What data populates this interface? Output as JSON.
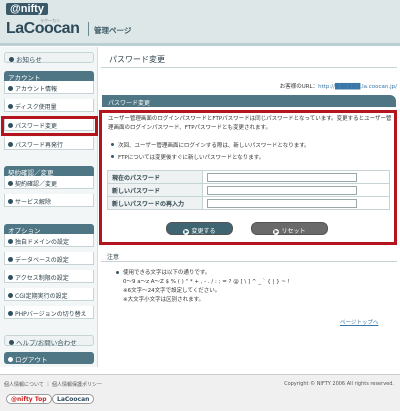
{
  "header": {
    "nifty": "@nifty",
    "ruby": "ラクーカン",
    "logo": "LaCoocan",
    "subtitle": "管理ページ"
  },
  "sidebar": {
    "notice": "お知らせ",
    "account_head": "アカウント",
    "account_items": [
      "アカウント情報",
      "ディスク使用量",
      "パスワード変更",
      "パスワード再発行"
    ],
    "contract_head": "契約確認／変更",
    "contract_items": [
      "契約確認／変更",
      "サービス解除"
    ],
    "option_head": "オプション",
    "option_items": [
      "独自ドメインの設定",
      "データベースの設定",
      "アクセス制限の設定",
      "CGI定期実行の設定",
      "PHPバージョンの切り替え"
    ],
    "help": "ヘルプ/お問い合わせ",
    "logout": "ログアウト"
  },
  "main": {
    "title": "パスワード変更",
    "welcome_prefix": "お客様のURL：",
    "welcome_url": "http://██████.la.coocan.jp/",
    "section": "パスワード変更",
    "desc": "ユーザー管理画面のログインパスワードとFTPパスワードは同じパスワードとなっています。変更するとユーザー管理画面のログインパスワード、FTPパスワードとも変更されます。",
    "note1": "次回、ユーザー管理画面にログインする際は、新しいパスワードとなります。",
    "note2": "FTPについては変更後すぐに新しいパスワードとなります。",
    "fields": [
      {
        "label": "現在のパスワード",
        "value": ""
      },
      {
        "label": "新しいパスワード",
        "value": ""
      },
      {
        "label": "新しいパスワードの再入力",
        "value": ""
      }
    ],
    "submit": "変更する",
    "reset": "リセット",
    "caution_title": "注意",
    "caution_lines": [
      "使用できる文字は以下の通りです。",
      "0〜9 a〜z A〜Z $ % ( ) \" * + , - . / : ; = ? @ [ \\ ] ^ _ ` { | } ~ !",
      "※6文字〜24文字で設定してください。",
      "※大文字小文字は区別されます。"
    ],
    "page_top": "ページトップへ"
  },
  "footer": {
    "links": "個人情報について ｜ 個人情報保護ポリシー",
    "copyright": "Copyright © NIFTY 2006 All rights reserved.",
    "logo1": "@nifty Top",
    "logo2": "LaCoocan"
  }
}
